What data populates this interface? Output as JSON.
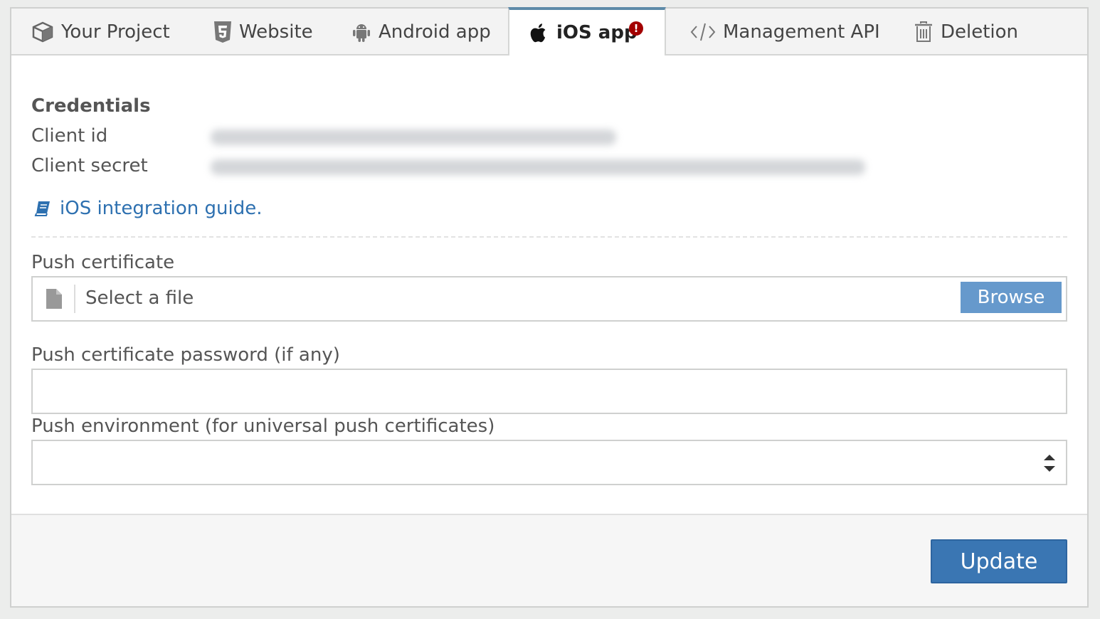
{
  "tabs": [
    {
      "label": "Your Project",
      "icon": "cube-icon"
    },
    {
      "label": "Website",
      "icon": "html5-icon"
    },
    {
      "label": "Android app",
      "icon": "android-icon"
    },
    {
      "label": "iOS app",
      "icon": "apple-icon",
      "active": true,
      "badge": "!"
    },
    {
      "label": "Management API",
      "icon": "code-icon"
    },
    {
      "label": "Deletion",
      "icon": "trash-icon"
    }
  ],
  "credentials": {
    "heading": "Credentials",
    "client_id_label": "Client id",
    "client_secret_label": "Client secret"
  },
  "guide": {
    "label": "iOS integration guide.",
    "icon": "book-icon"
  },
  "push_certificate": {
    "label": "Push certificate",
    "placeholder": "Select a file",
    "browse_label": "Browse"
  },
  "password": {
    "label": "Push certificate password (if any)",
    "value": ""
  },
  "environment": {
    "label": "Push environment (for universal push certificates)",
    "value": ""
  },
  "footer": {
    "update_label": "Update"
  },
  "colors": {
    "accent": "#3a76b3",
    "browse": "#6699cc",
    "link": "#2d70b0",
    "badge": "#a30000",
    "active_tab_border": "#5d8aa8"
  }
}
